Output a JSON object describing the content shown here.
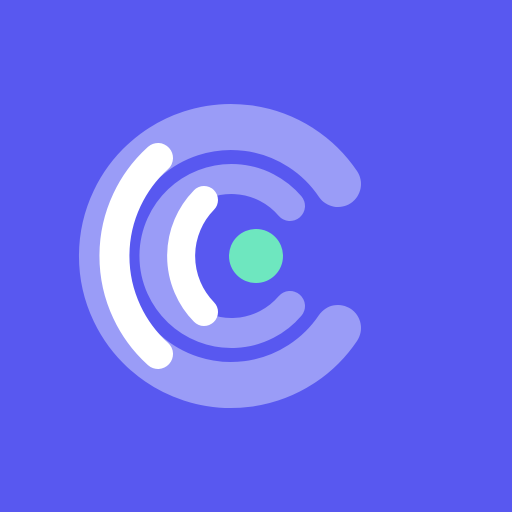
{
  "icon": {
    "name": "app-logo-c-signal",
    "colors": {
      "background": "#5858F0",
      "c_track": "#9A9CF7",
      "arcs": "#FFFFFF",
      "dot": "#6EE7BF"
    }
  }
}
